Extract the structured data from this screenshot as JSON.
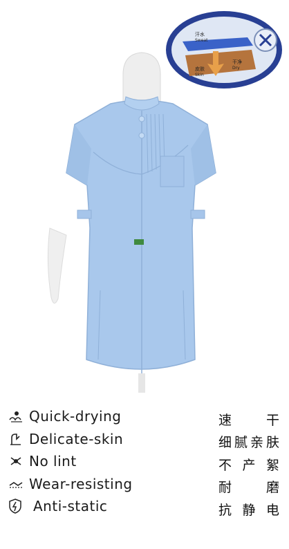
{
  "features": [
    {
      "icon": "quick-dry-icon",
      "label": "Quick-drying"
    },
    {
      "icon": "delicate-skin-icon",
      "label": "Delicate-skin"
    },
    {
      "icon": "no-lint-icon",
      "label": "No lint"
    },
    {
      "icon": "wear-resist-icon",
      "label": "Wear-resisting"
    },
    {
      "icon": "anti-static-icon",
      "label": "Anti-static"
    }
  ],
  "cn_features": [
    [
      "速",
      "干"
    ],
    [
      "细",
      "腻",
      "亲",
      "肤"
    ],
    [
      "不",
      "产",
      "絮"
    ],
    [
      "耐",
      "磨"
    ],
    [
      "抗",
      "静",
      "电"
    ]
  ],
  "badge": {
    "labels": [
      "汗水",
      "Sweat",
      "皮肤",
      "Skin",
      "干净",
      "Dry"
    ]
  },
  "colors": {
    "garment": "#a9c8ec",
    "badge_ring": "#283f93",
    "badge_inner": "#dfe7f4"
  }
}
